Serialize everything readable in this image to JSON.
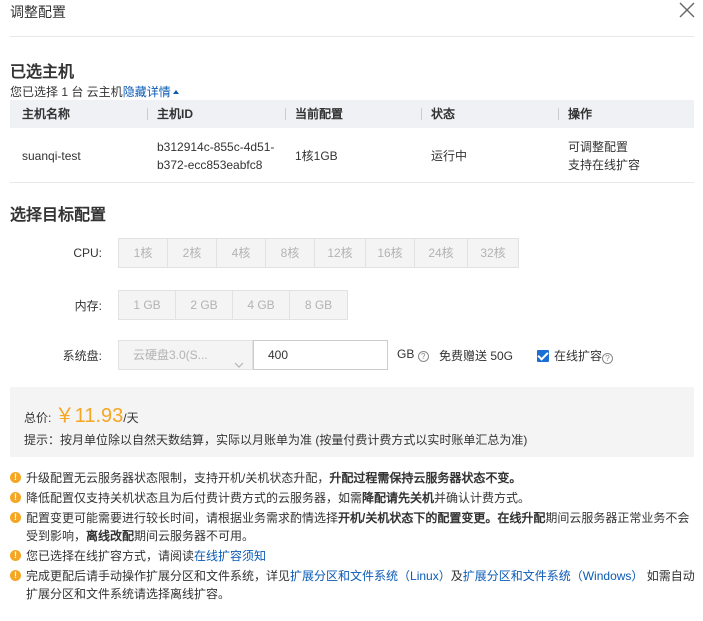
{
  "dialog": {
    "title": "调整配置",
    "close_icon": "close-icon"
  },
  "selected": {
    "heading": "已选主机",
    "count_text": "您已选择 1 台 云主机",
    "toggle_link": "隐藏详情",
    "table": {
      "headers": [
        "主机名称",
        "主机ID",
        "当前配置",
        "状态",
        "操作"
      ],
      "row": {
        "name": "suanqi-test",
        "id_line1": "b312914c-855c-4d51-",
        "id_line2": "b372-ecc853eabfc8",
        "config": "1核1GB",
        "status": "运行中",
        "op_line1": "可调整配置",
        "op_line2": "支持在线扩容"
      }
    }
  },
  "target": {
    "heading": "选择目标配置",
    "cpu_label": "CPU:",
    "cpu_options": [
      "1核",
      "2核",
      "4核",
      "8核",
      "12核",
      "16核",
      "24核",
      "32核"
    ],
    "mem_label": "内存:",
    "mem_options": [
      "1 GB",
      "2 GB",
      "4 GB",
      "8 GB"
    ],
    "disk_label": "系统盘:",
    "disk_type": "云硬盘3.0(S...",
    "disk_size": "400",
    "disk_unit": "GB",
    "disk_free": "免费赠送 50G",
    "online_expand_label": "在线扩容",
    "online_expand_checked": true
  },
  "price": {
    "label": "总价:",
    "amount": "￥11.93",
    "unit": "/天",
    "tip": "提示：按月单位除以自然天数结算，实际以月账单为准 (按量付费计费方式以实时账单汇总为准)"
  },
  "notes": {
    "n1_a": "升级配置无云服务器状态限制，支持开机/关机状态升配，",
    "n1_b": "升配过程需保持云服务器状态不变。",
    "n2_a": "降低配置仅支持关机状态且为后付费计费方式的云服务器，如需",
    "n2_b": "降配请先关机",
    "n2_c": "并确认计费方式。",
    "n3_a": "配置变更可能需要进行较长时间，请根据业务需求酌情选择",
    "n3_b": "开机/关机状态下的配置变更。在线升配",
    "n3_c": "期间云服务器正常业务不会受到影响，",
    "n3_d": "离线改配",
    "n3_e": "期间云服务器不可用。",
    "n4_a": "您已选择在线扩容方式，请阅读",
    "n4_link": "在线扩容须知",
    "n5_a": "完成更配后请手动操作扩展分区和文件系统，详见",
    "n5_link1": "扩展分区和文件系统（Linux）",
    "n5_b": "及",
    "n5_link2": "扩展分区和文件系统（Windows）",
    "n5_c": " 如需自动扩展分区和文件系统请选择离线扩容。"
  },
  "colors": {
    "accent": "#0b5bb5",
    "price": "#f5a623",
    "warning": "#f5a623",
    "checkbox": "#1b6fd2"
  }
}
